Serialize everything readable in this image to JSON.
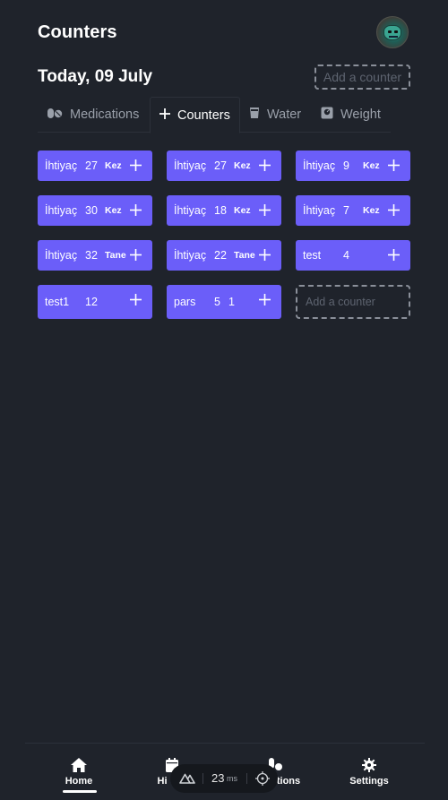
{
  "header": {
    "title": "Counters"
  },
  "date_title": "Today, 09 July",
  "add_counter_label": "Add a counter",
  "tabs": [
    {
      "label": "Medications",
      "icon": "pills-icon",
      "active": false
    },
    {
      "label": "Counters",
      "icon": "plus-icon",
      "active": true
    },
    {
      "label": "Water",
      "icon": "glass-icon",
      "active": false
    },
    {
      "label": "Weight",
      "icon": "scale-icon",
      "active": false
    }
  ],
  "counters": [
    {
      "name": "İhtiyaç",
      "value": "27",
      "unit": "Kez"
    },
    {
      "name": "İhtiyaç",
      "value": "27",
      "unit": "Kez"
    },
    {
      "name": "İhtiyaç",
      "value": "9",
      "unit": "Kez"
    },
    {
      "name": "İhtiyaç",
      "value": "30",
      "unit": "Kez"
    },
    {
      "name": "İhtiyaç",
      "value": "18",
      "unit": "Kez"
    },
    {
      "name": "İhtiyaç",
      "value": "7",
      "unit": "Kez"
    },
    {
      "name": "İhtiyaç",
      "value": "32",
      "unit": "Tane"
    },
    {
      "name": "İhtiyaç",
      "value": "22",
      "unit": "Tane"
    },
    {
      "name": "test",
      "value": "4",
      "unit": ""
    },
    {
      "name": "test1",
      "value": "12",
      "unit": ""
    },
    {
      "name": "pars",
      "value": "5",
      "unit": "1"
    }
  ],
  "nav": {
    "home": "Home",
    "history": "Hi",
    "medications": "tions",
    "settings": "Settings"
  },
  "dev": {
    "ms_value": "23",
    "ms_unit": "ms"
  },
  "colors": {
    "accent": "#6b5ef9",
    "background": "#1f232b"
  }
}
